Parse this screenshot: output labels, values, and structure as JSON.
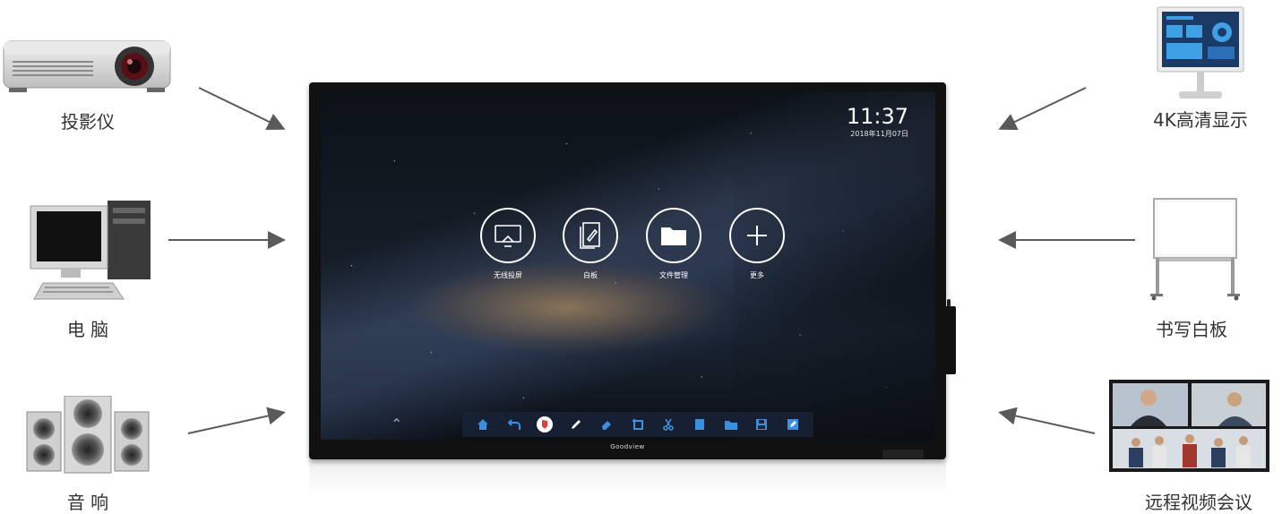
{
  "devices": {
    "projector": {
      "label": "投影仪",
      "icon": "projector-icon"
    },
    "computer": {
      "label": "电 脑",
      "icon": "desktop-computer-icon"
    },
    "speakers": {
      "label": "音 响",
      "icon": "speaker-icon"
    },
    "monitor_4k": {
      "label": "4K高清显示",
      "icon": "monitor-icon"
    },
    "whiteboard": {
      "label": "书写白板",
      "icon": "whiteboard-icon"
    },
    "video_conf": {
      "label": "远程视频会议",
      "icon": "video-conference-icon"
    }
  },
  "screen": {
    "time": "11:37",
    "date": "2018年11月07日",
    "brand": "Goodview",
    "apps": [
      {
        "label": "无线投屏",
        "icon": "wireless-cast-icon"
      },
      {
        "label": "白板",
        "icon": "whiteboard-doc-icon"
      },
      {
        "label": "文件管理",
        "icon": "folder-icon"
      },
      {
        "label": "更多",
        "icon": "plus-icon"
      }
    ],
    "toolbar": [
      "home-icon",
      "undo-icon",
      "erase-hand-icon",
      "pen-icon",
      "eraser-icon",
      "crop-icon",
      "scissors-icon",
      "page-icon",
      "folder-icon",
      "save-icon",
      "edit-icon"
    ]
  },
  "colors": {
    "arrow": "#5a5a5a",
    "toolbar_icon": "#3a8fe0",
    "accent_red": "#e03a3a"
  }
}
